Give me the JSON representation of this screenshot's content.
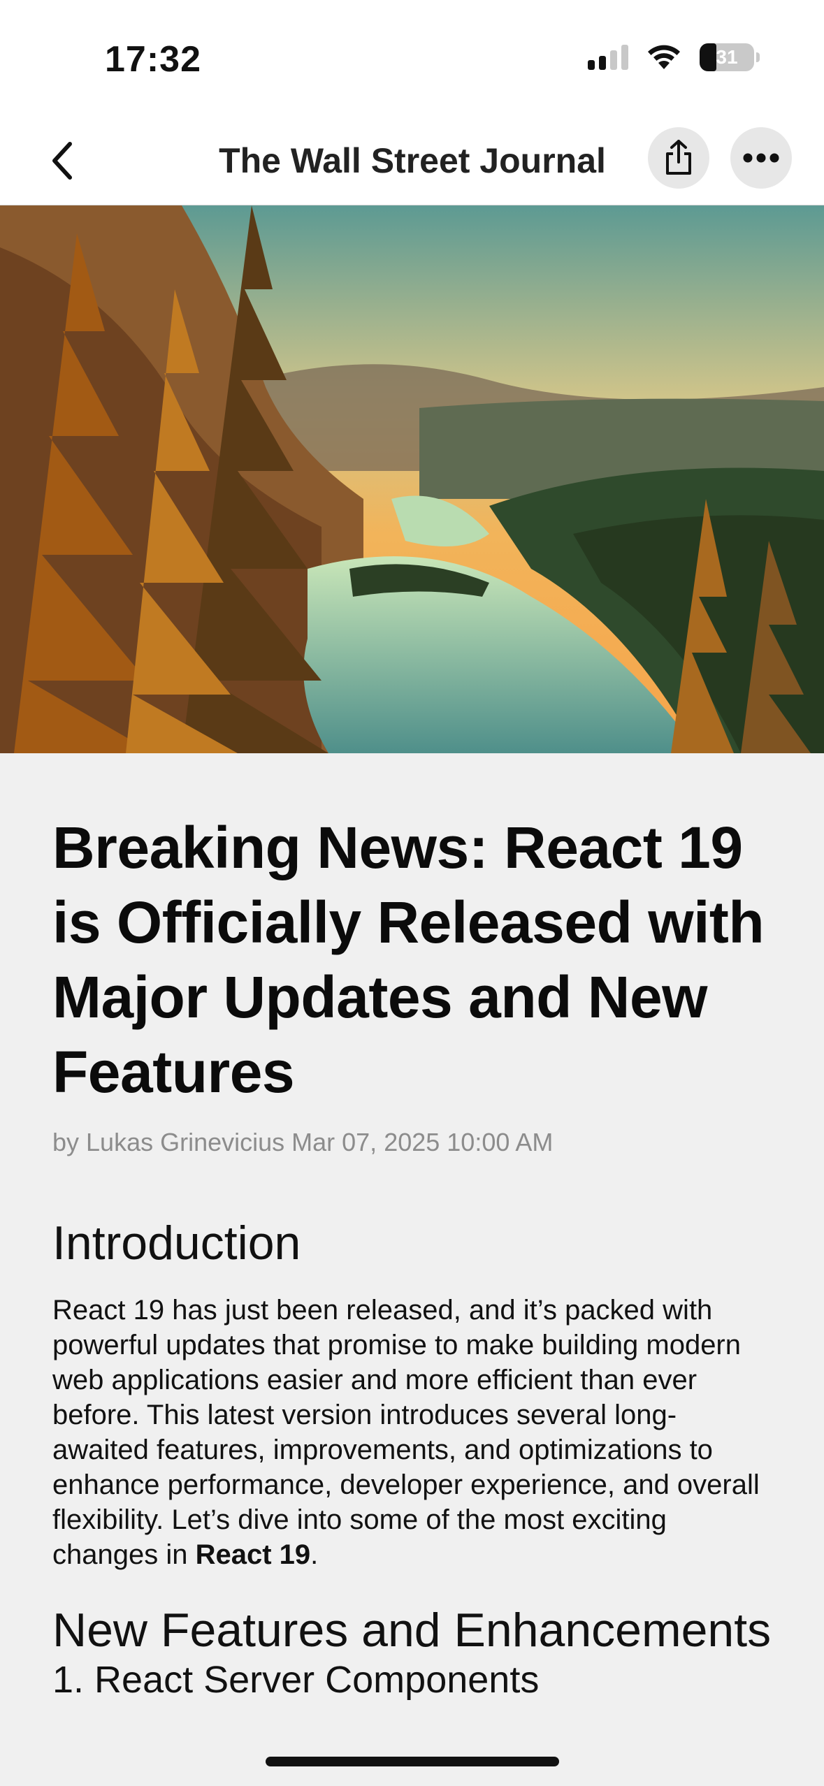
{
  "status_bar": {
    "time": "17:32",
    "battery_percent": "31",
    "battery_level": 0.31
  },
  "nav": {
    "title": "The Wall Street Journal",
    "icons": [
      "chevron-left-icon",
      "share-icon",
      "more-horizontal-icon"
    ]
  },
  "hero_image": {
    "subject": "mountain-lake-sunset-photo"
  },
  "article": {
    "headline": "Breaking News: React 19 is Officially Released with Major Updates and New Features",
    "byline": "by Lukas Grinevicius Mar 07, 2025 10:00 AM",
    "intro_title": "Introduction",
    "intro_text": "React 19 has just been released, and it’s packed with powerful updates that promise to make building modern web applications easier and more efficient than ever before. This latest version introduces several long-awaited features, improvements, and optimizations to enhance performance, developer experience, and overall flexibility. Let’s dive into some of the most exciting changes in ",
    "intro_bold": "React 19",
    "intro_end": ".",
    "features_title": "New Features and Enhancements",
    "feature_1_title": "1. React Server Components"
  },
  "colors": {
    "background": "#f0f0f0",
    "bar_background": "#ffffff",
    "byline": "#8c8c8c",
    "button_background": "#e7e7e7"
  }
}
